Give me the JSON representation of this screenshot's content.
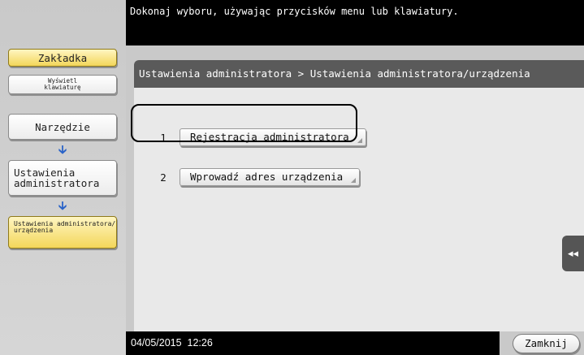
{
  "topbar": {
    "instruction": "Dokonaj wyboru, używając przycisków menu lub klawiatury."
  },
  "sidebar": {
    "tab_button": "Zakładka",
    "keyboard_button": "Wyświetl klawiaturę",
    "path": [
      {
        "label": "Narzędzie"
      },
      {
        "label": "Ustawienia administratora"
      },
      {
        "label": "Ustawienia administratora/ urządzenia"
      }
    ]
  },
  "main": {
    "breadcrumb": "Ustawienia administratora > Ustawienia administratora/urządzenia",
    "items": [
      {
        "number": "1",
        "label": "Rejestracja administratora"
      },
      {
        "number": "2",
        "label": "Wprowadź adres urządzenia"
      }
    ]
  },
  "side_tab": {
    "icon": "double-chevron-left-icon",
    "glyph": "◂◂"
  },
  "footer": {
    "datetime": "04/05/2015  12:26",
    "close_label": "Zamknij"
  },
  "colors": {
    "panel_background": "#e9e9e9",
    "frame_gray": "#c9c9c9",
    "breadcrumb_bar": "#5a5a5a",
    "highlight_yellow": "#f3d65a",
    "arrow_blue": "#2a63c8"
  }
}
